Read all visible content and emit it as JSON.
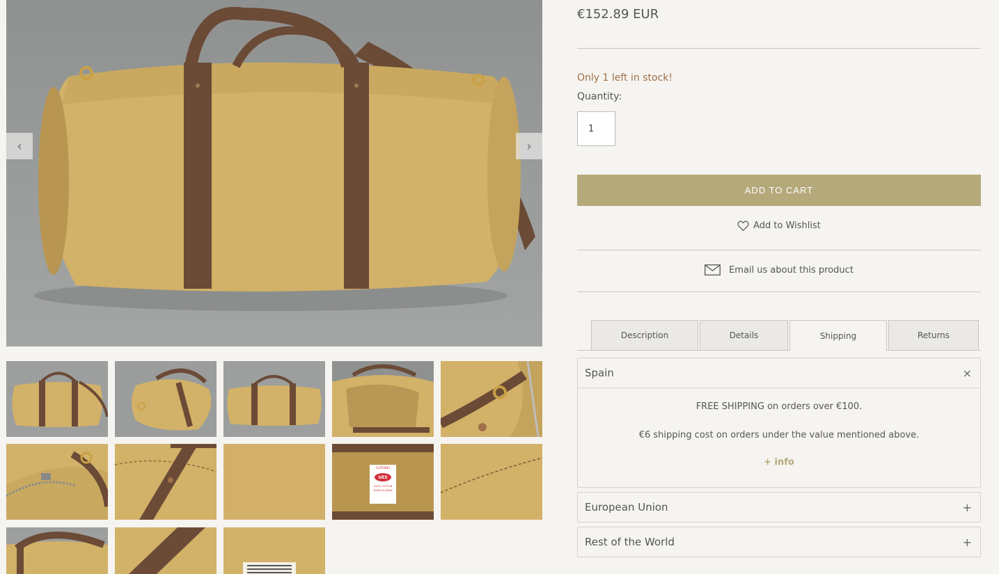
{
  "gallery": {
    "prev_icon": "chevron-left-icon",
    "next_icon": "chevron-right-icon",
    "prev_glyph": "‹",
    "next_glyph": "›",
    "label_text": [
      "CLOTHING",
      "UES",
      "100% COTTON",
      "MADE IN JAPAN"
    ]
  },
  "product": {
    "price": "€152.89 EUR",
    "stock_notice": "Only 1 left in stock!",
    "quantity_label": "Quantity:",
    "quantity_value": "1",
    "add_to_cart": "ADD TO CART",
    "wishlist": "Add to Wishlist",
    "email": "Email us about this product"
  },
  "tabs": [
    {
      "label": "Description"
    },
    {
      "label": "Details"
    },
    {
      "label": "Shipping"
    },
    {
      "label": "Returns"
    }
  ],
  "shipping": {
    "regions": [
      {
        "name": "Spain",
        "symbol": "×"
      },
      {
        "name": "European Union",
        "symbol": "+"
      },
      {
        "name": "Rest of the World",
        "symbol": "+"
      }
    ],
    "spain_line1": "FREE SHIPPING on orders over €100.",
    "spain_line2": "€6 shipping cost on orders under the value mentioned above.",
    "info_link": "+ info"
  },
  "colors": {
    "accent": "#b5a87a",
    "stock": "#a0704a",
    "canvas": "#d2b168",
    "strap": "#6b4a36"
  }
}
